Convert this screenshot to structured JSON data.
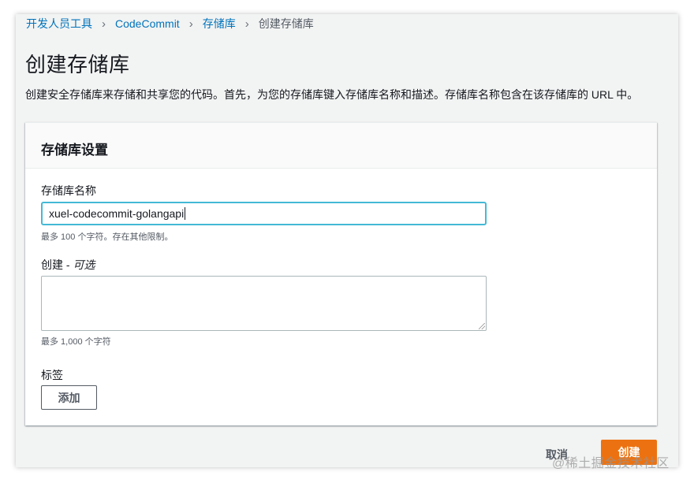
{
  "breadcrumb": {
    "items": [
      "开发人员工具",
      "CodeCommit",
      "存储库"
    ],
    "current": "创建存储库"
  },
  "page": {
    "title": "创建存储库",
    "description": "创建安全存储库来存储和共享您的代码。首先，为您的存储库键入存储库名称和描述。存储库名称包含在该存储库的 URL 中。"
  },
  "settings": {
    "title": "存储库设置",
    "name_label": "存储库名称",
    "name_value": "xuel-codecommit-golangapi",
    "name_hint": "最多 100 个字符。存在其他限制。",
    "desc_label": "创建 - ",
    "desc_optional": "可选",
    "desc_value": "",
    "desc_hint": "最多 1,000 个字符",
    "tags_label": "标签",
    "add_label": "添加"
  },
  "actions": {
    "cancel": "取消",
    "create": "创建"
  },
  "watermark": "@稀土掘金技术社区",
  "colors": {
    "link": "#0073bb",
    "primary": "#ec7211",
    "focus": "#44b9d6"
  }
}
